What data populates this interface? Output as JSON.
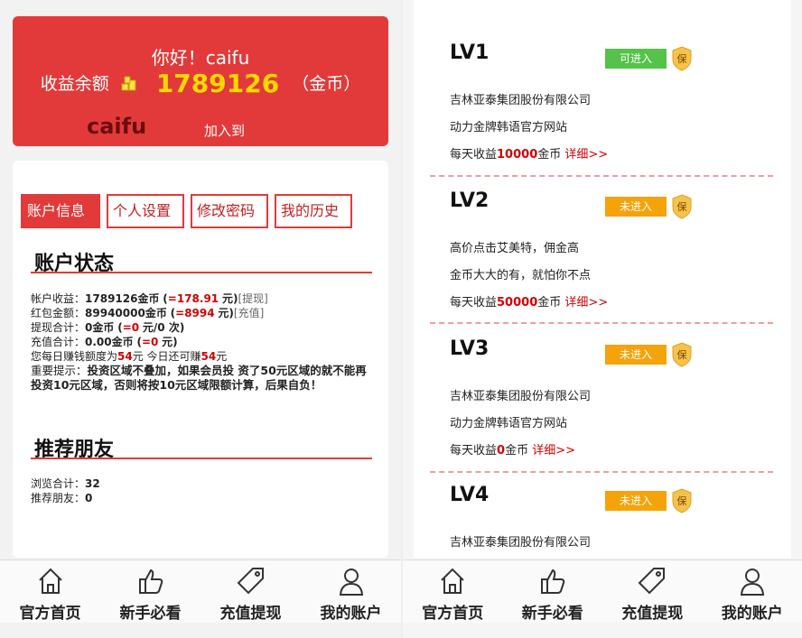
{
  "left": {
    "greeting": "你好！caifu",
    "balance_label": "收益余额",
    "balance_value": "1789126",
    "balance_unit": "（金币）",
    "username": "caifu",
    "join_text": "加入到",
    "tabs": [
      "账户信息",
      "个人设置",
      "修改密码",
      "我的历史"
    ],
    "account_status_title": "账户状态",
    "rows": {
      "r1_label": "帐户收益：",
      "r1_value": "1789126金币",
      "r1_paren_open": "(",
      "r1_red": "=178.91",
      "r1_tail": "元)",
      "r1_link": "[提现]",
      "r2_label": "红包金额：",
      "r2_value": "89940000金币",
      "r2_paren_open": "(",
      "r2_red": "=8994",
      "r2_tail": "元)",
      "r2_link": "[充值]",
      "r3_label": "提现合计：",
      "r3_value": "0金币",
      "r3_paren_open": "(",
      "r3_red": "=0",
      "r3_tail": "元/0 次)",
      "r4_label": "充值合计：",
      "r4_value": "0.00金币",
      "r4_paren_open": "(",
      "r4_red": "=0",
      "r4_tail": "元)",
      "r5_a": "您每日赚钱额度为",
      "r5_red1": "54",
      "r5_b": "元 今日还可赚",
      "r5_red2": "54",
      "r5_c": "元",
      "warn_label": "重要提示：",
      "warn_text": "投资区域不叠加，如果会员投 资了50元区域的就不能再投资10元区域，否则将按10元区域限额计算，后果自负！"
    },
    "referral_title": "推荐朋友",
    "ref_views_label": "浏览合计：",
    "ref_views_value": "32",
    "ref_friends_label": "推荐朋友：",
    "ref_friends_value": "0"
  },
  "nav": [
    "官方首页",
    "新手必看",
    "充值提现",
    "我的账户"
  ],
  "levels": [
    {
      "title": "LV1",
      "badge": "可进入",
      "badge_color": "#55c24a",
      "line1": "吉林亚泰集团股份有限公司",
      "line2": "动力金牌韩语官方网站",
      "income_pre": "每天收益",
      "income_val": "10000",
      "income_post": "金币",
      "detail": "详细>>"
    },
    {
      "title": "LV2",
      "badge": "未进入",
      "badge_color": "#f4a30a",
      "line1": "高价点击艾美特，佣金高",
      "line2": "金币大大的有，就怕你不点",
      "income_pre": "每天收益",
      "income_val": "50000",
      "income_post": "金币",
      "detail": "详细>>"
    },
    {
      "title": "LV3",
      "badge": "未进入",
      "badge_color": "#f4a30a",
      "line1": "吉林亚泰集团股份有限公司",
      "line2": "动力金牌韩语官方网站",
      "income_pre": "每天收益",
      "income_val": "0",
      "income_post": "金币",
      "detail": "详细>>"
    },
    {
      "title": "LV4",
      "badge": "未进入",
      "badge_color": "#f4a30a",
      "line1": "吉林亚泰集团股份有限公司"
    }
  ],
  "shield_char": "保",
  "icons": {
    "coin": "gold-coins-icon",
    "home": "home-icon",
    "guide": "thumbs-up-icon",
    "finance": "tag-icon",
    "account": "user-icon",
    "level": "shield-icon"
  },
  "colors": {
    "brand_red": "#e23a3a",
    "gold": "#ffd800",
    "green_badge": "#55c24a",
    "orange_badge": "#f4a30a"
  }
}
